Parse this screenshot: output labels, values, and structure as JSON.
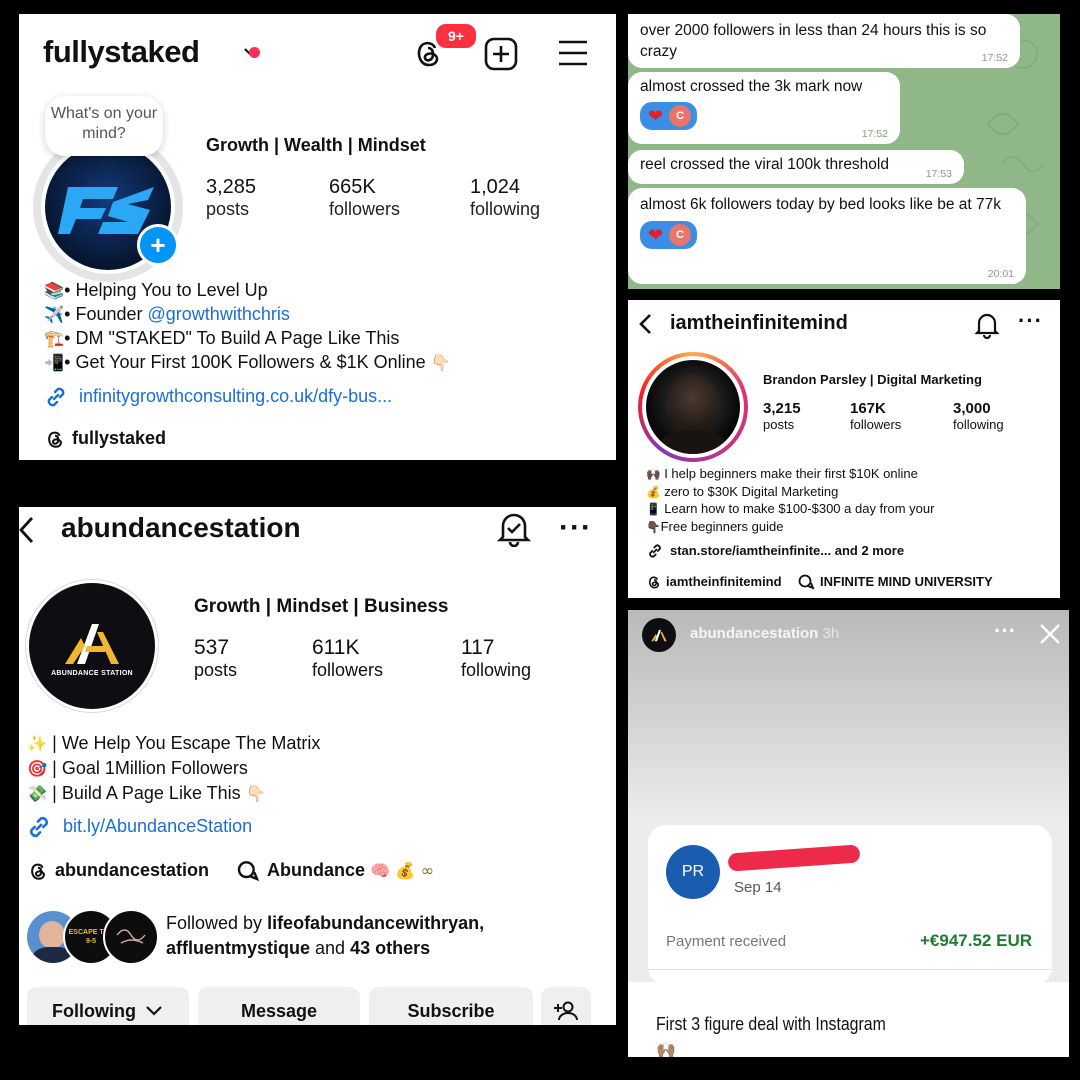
{
  "profile1": {
    "handle": "fullystaked",
    "notification_badge": "9+",
    "thought_bubble": "What's on your mind?",
    "category": "Growth | Wealth | Mindset",
    "stats": [
      {
        "value": "3,285",
        "label": "posts"
      },
      {
        "value": "665K",
        "label": "followers"
      },
      {
        "value": "1,024",
        "label": "following"
      }
    ],
    "bio": [
      {
        "emoji": "📚",
        "text": "• Helping You to Level Up"
      },
      {
        "emoji": "✈️",
        "text": "• Founder ",
        "link": "@growthwithchris"
      },
      {
        "emoji": "🏗️",
        "text": "• DM \"STAKED\" To Build A Page Like This"
      },
      {
        "emoji": "📲",
        "text": "• Get Your First 100K Followers & $1K Online",
        "tail": "👇🏻"
      }
    ],
    "website": "infinitygrowthconsulting.co.uk/dfy-bus...",
    "threads_handle": "fullystaked",
    "avatar_letters": "FS"
  },
  "chat": {
    "messages": [
      {
        "text": "over 2000 followers in less than 24 hours this is so crazy",
        "time": "17:52"
      },
      {
        "text": "almost crossed the 3k mark now",
        "time": "17:52",
        "reaction": "❤",
        "reactor": "C"
      },
      {
        "text": "reel crossed the viral 100k threshold",
        "time": "17:53"
      },
      {
        "text": "almost 6k followers today by bed looks like be at 77k",
        "time": "20:01",
        "reaction": "❤",
        "reactor": "C"
      }
    ]
  },
  "profile2": {
    "handle": "iamtheinfinitemind",
    "name": "Brandon Parsley | Digital Marketing",
    "stats": [
      {
        "value": "3,215",
        "label": "posts"
      },
      {
        "value": "167K",
        "label": "followers"
      },
      {
        "value": "3,000",
        "label": "following"
      }
    ],
    "bio": [
      {
        "emoji": "🙌🏿",
        "text": "I help beginners make their first $10K online"
      },
      {
        "emoji": "💰",
        "text": "zero to $30K Digital Marketing"
      },
      {
        "emoji": "📱",
        "text": "Learn how to make $100-$300 a day from your"
      },
      {
        "emoji": "👇🏿",
        "text": "Free beginners guide"
      }
    ],
    "link": "stan.store/iamtheinfinite...",
    "link_more": "and 2 more",
    "threads_handle": "iamtheinfinitemind",
    "community": "INFINITE MIND UNIVERSITY"
  },
  "profile3": {
    "handle": "abundancestation",
    "category": "Growth | Mindset | Business",
    "stats": [
      {
        "value": "537",
        "label": "posts"
      },
      {
        "value": "611K",
        "label": "followers"
      },
      {
        "value": "117",
        "label": "following"
      }
    ],
    "logo_text": "ABUNDANCE STATION",
    "bio": [
      {
        "emoji": "✨",
        "text": "| We Help You Escape The Matrix"
      },
      {
        "emoji": "🎯",
        "text": "| Goal 1Million Followers"
      },
      {
        "emoji": "💸",
        "text": "| Build A Page Like This",
        "tail": "👇🏻"
      }
    ],
    "link": "bit.ly/AbundanceStation",
    "threads_handle": "abundancestation",
    "community": "Abundance",
    "community_tail": "🧠 💰 ∞",
    "followed_by_prefix": "Followed by ",
    "followed_by_1": "lifeofabundancewithryan,",
    "followed_by_2": "affluentmystique",
    "followed_by_and": " and ",
    "followed_by_others": "43 others",
    "follower_avatar_2": "ESCAPE THE 9-5",
    "buttons": {
      "following": "Following",
      "message": "Message",
      "subscribe": "Subscribe"
    }
  },
  "story": {
    "handle": "abundancestation",
    "age": "3h",
    "payer_initials": "PR",
    "date": "Sep 14",
    "payment_label": "Payment received",
    "amount": "+€947.52 EUR",
    "caption": "First 3 figure deal with Instagram",
    "caption_emoji": "🙌🏽"
  }
}
